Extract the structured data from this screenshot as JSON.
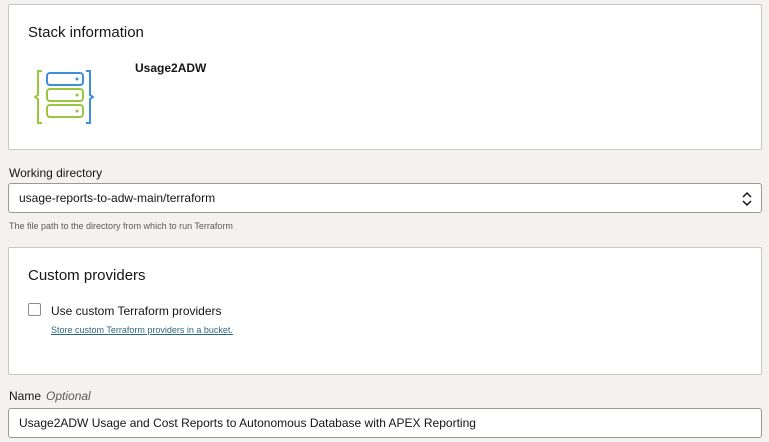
{
  "stack_info": {
    "title": "Stack information",
    "name": "Usage2ADW",
    "icon": "stack-database-icon"
  },
  "working_directory": {
    "label": "Working directory",
    "value": "usage-reports-to-adw-main/terraform",
    "help": "The file path to the directory from which to run Terraform"
  },
  "custom_providers": {
    "title": "Custom providers",
    "checkbox_label": "Use custom Terraform providers",
    "checked": false,
    "link": "Store custom Terraform providers in a bucket."
  },
  "name_field": {
    "label": "Name",
    "optional": "Optional",
    "value": "Usage2ADW Usage and Cost Reports to Autonomous Database with APEX Reporting"
  },
  "colors": {
    "icon_blue": "#3d8fd9",
    "icon_green": "#9bc53d",
    "link": "#2b6a7c"
  }
}
